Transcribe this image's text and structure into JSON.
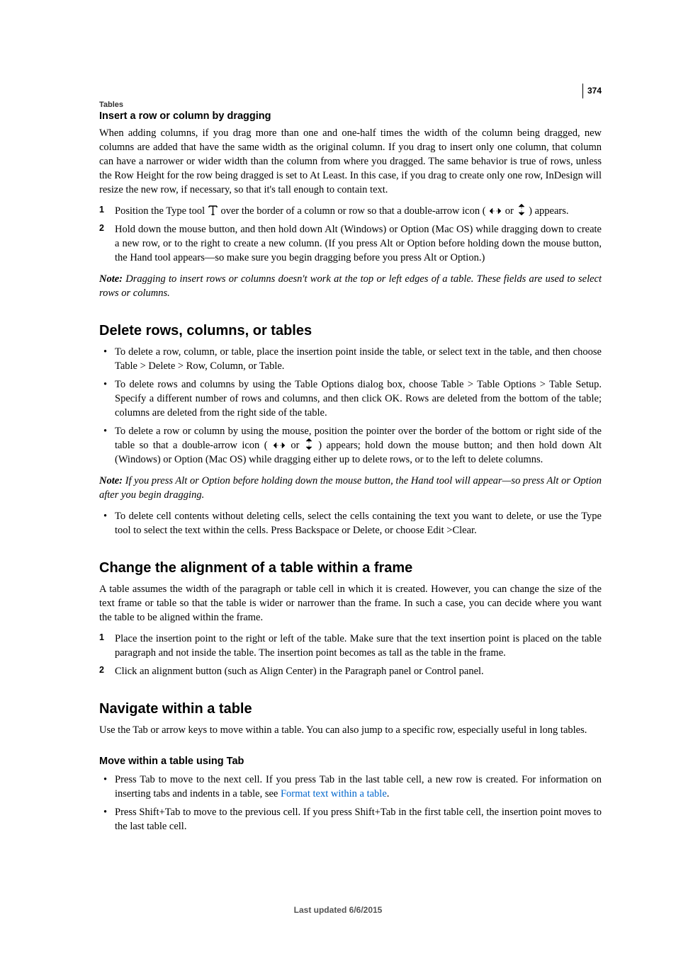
{
  "breadcrumb": "Tables",
  "page_number": "374",
  "footer": "Last updated 6/6/2015",
  "sec1": {
    "heading": "Insert a row or column by dragging",
    "p1": "When adding columns, if you drag more than one and one-half times the width of the column being dragged, new columns are added that have the same width as the original column. If you drag to insert only one column, that column can have a narrower or wider width than the column from where you dragged. The same behavior is true of rows, unless the Row Height for the row being dragged is set to At Least. In this case, if you drag to create only one row, InDesign will resize the new row, if necessary, so that it's tall enough to contain text.",
    "step1a": "Position the Type tool ",
    "step1b": " over the border of a column or row so that a double-arrow icon ( ",
    "step1c": " or ",
    "step1d": " ) appears.",
    "step2": "Hold down the mouse button, and then hold down Alt (Windows) or Option (Mac OS) while dragging down to create a new row, or to the right to create a new column. (If you press Alt or Option before holding down the mouse button, the Hand tool appears—so make sure you begin dragging before you press Alt or Option.)",
    "note_label": "Note: ",
    "note": "Dragging to insert rows or columns doesn't work at the top or left edges of a table. These fields are used to select rows or columns."
  },
  "sec2": {
    "heading": "Delete rows, columns, or tables",
    "b1": "To delete a row, column, or table, place the insertion point inside the table, or select text in the table, and then choose Table > Delete > Row, Column, or Table.",
    "b2": "To delete rows and columns by using the Table Options dialog box, choose Table > Table Options > Table Setup. Specify a different number of rows and columns, and then click OK. Rows are deleted from the bottom of the table; columns are deleted from the right side of the table.",
    "b3a": "To delete a row or column by using the mouse, position the pointer over the border of the bottom or right side of the table so that a double-arrow icon ( ",
    "b3b": " or ",
    "b3c": " ) appears; hold down the mouse button; and then hold down Alt (Windows) or Option (Mac OS) while dragging either up to delete rows, or to the left to delete columns.",
    "note_label": "Note: ",
    "note": "If you press Alt or Option before holding down the mouse button, the Hand tool will appear—so press Alt or Option after you begin dragging.",
    "b4": "To delete cell contents without deleting cells, select the cells containing the text you want to delete, or use the Type tool to select the text within the cells. Press Backspace or Delete, or choose Edit >Clear."
  },
  "sec3": {
    "heading": "Change the alignment of a table within a frame",
    "p1": "A table assumes the width of the paragraph or table cell in which it is created. However, you can change the size of the text frame or table so that the table is wider or narrower than the frame. In such a case, you can decide where you want the table to be aligned within the frame.",
    "step1": "Place the insertion point to the right or left of the table. Make sure that the text insertion point is placed on the table paragraph and not inside the table. The insertion point becomes as tall as the table in the frame.",
    "step2": "Click an alignment button (such as Align Center) in the Paragraph panel or Control panel."
  },
  "sec4": {
    "heading": "Navigate within a table",
    "p1": "Use the Tab or arrow keys to move within a table. You can also jump to a specific row, especially useful in long tables.",
    "sub_heading": "Move within a table using Tab",
    "b1a": "Press Tab to move to the next cell. If you press Tab in the last table cell, a new row is created. For information on inserting tabs and indents in a table, see ",
    "b1_link": "Format text within a table",
    "b1b": ".",
    "b2": "Press Shift+Tab to move to the previous cell. If you press Shift+Tab in the first table cell, the insertion point moves to the last table cell."
  }
}
